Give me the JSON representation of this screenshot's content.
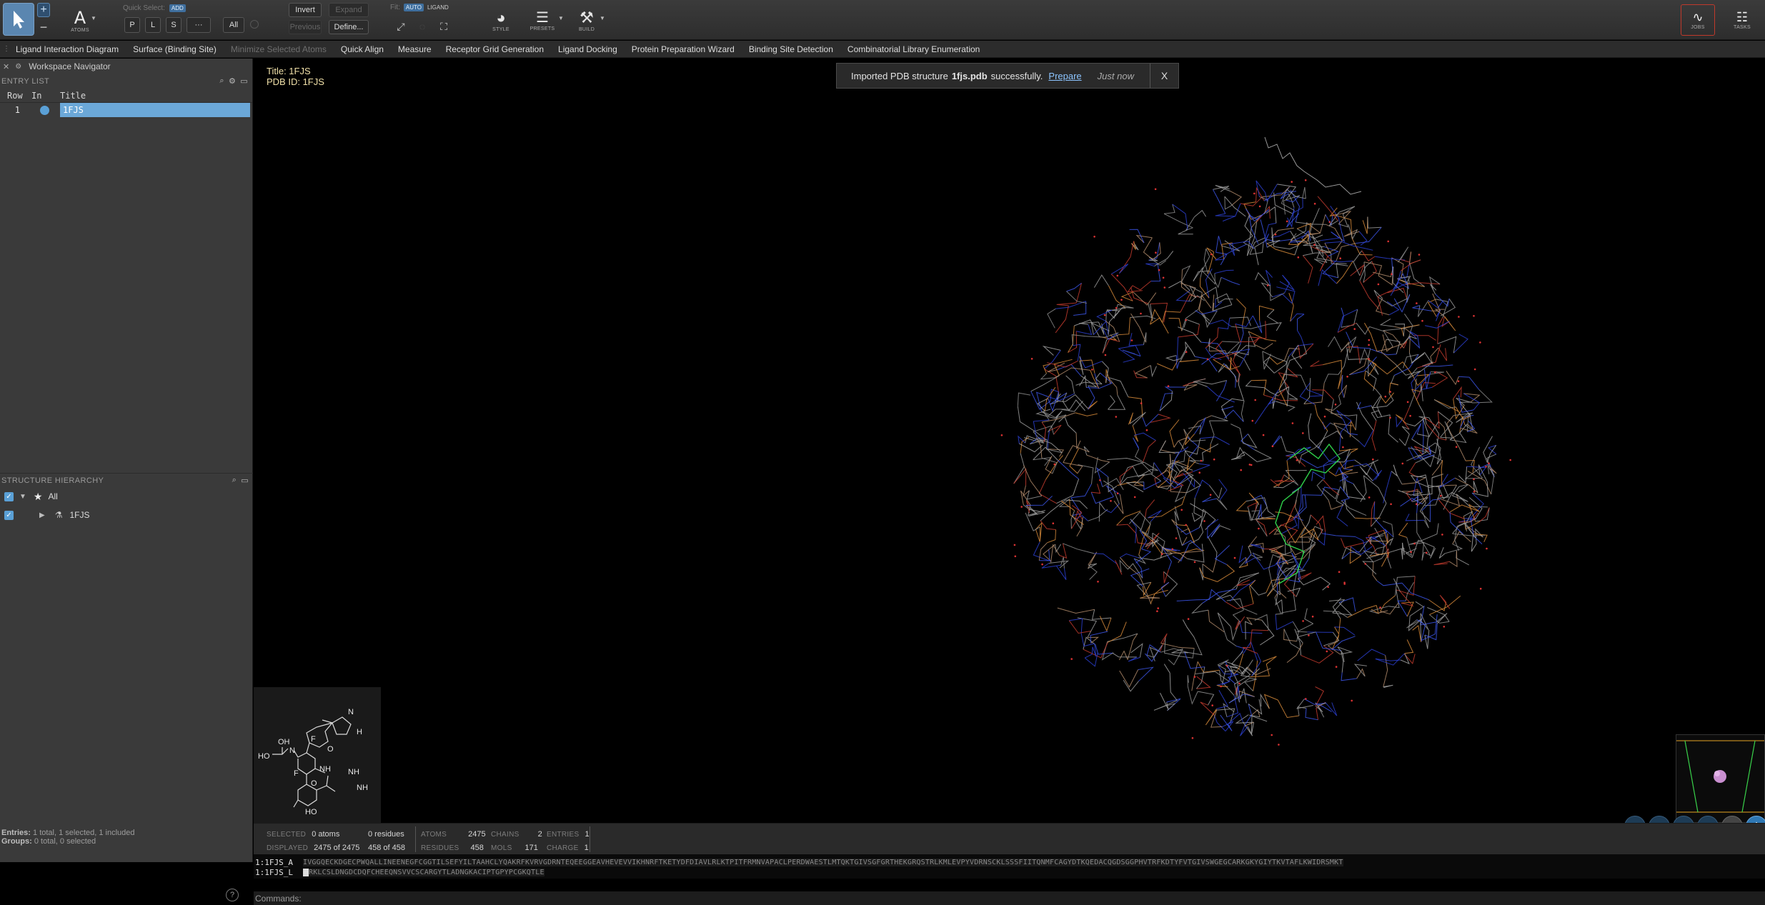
{
  "toolbar": {
    "atoms_label": "ATOMS",
    "quick_select_label": "Quick Select:",
    "quick_select_badge": "ADD",
    "btn_p": "P",
    "btn_l": "L",
    "btn_s": "S",
    "btn_more": "···",
    "btn_all": "All",
    "invert": "Invert",
    "expand": "Expand",
    "previous": "Previous",
    "define": "Define...",
    "fit_label": "Fit:",
    "fit_auto": "AUTO",
    "fit_ligand": "LIGAND",
    "style_label": "STYLE",
    "presets_label": "PRESETS",
    "build_label": "BUILD",
    "jobs_label": "JOBS",
    "tasks_label": "TASKS"
  },
  "menu": [
    {
      "label": "Ligand Interaction Diagram",
      "enabled": true
    },
    {
      "label": "Surface (Binding Site)",
      "enabled": true
    },
    {
      "label": "Minimize Selected Atoms",
      "enabled": false
    },
    {
      "label": "Quick Align",
      "enabled": true
    },
    {
      "label": "Measure",
      "enabled": true
    },
    {
      "label": "Receptor Grid Generation",
      "enabled": true
    },
    {
      "label": "Ligand Docking",
      "enabled": true
    },
    {
      "label": "Protein Preparation Wizard",
      "enabled": true
    },
    {
      "label": "Binding Site Detection",
      "enabled": true
    },
    {
      "label": "Combinatorial Library Enumeration",
      "enabled": true
    }
  ],
  "navigator": {
    "title": "Workspace Navigator",
    "entry_list_label": "ENTRY LIST",
    "columns": [
      "Row",
      "In",
      "Title"
    ],
    "rows": [
      {
        "row": "1",
        "title": "1FJS"
      }
    ],
    "structure_hierarchy_label": "STRUCTURE HIERARCHY",
    "hierarchy": [
      {
        "label": "All"
      },
      {
        "label": "1FJS"
      }
    ]
  },
  "status": {
    "entries_label": "Entries:",
    "entries_value": "1 total, 1 selected, 1 included",
    "groups_label": "Groups:",
    "groups_value": "0 total, 0 selected"
  },
  "viewer": {
    "title_line": "Title: 1FJS",
    "pdb_line": "PDB ID: 1FJS",
    "toast_prefix": "Imported PDB structure",
    "toast_file": "1fjs.pdb",
    "toast_suffix": "successfully.",
    "toast_link": "Prepare",
    "toast_time": "Just now",
    "toast_close": "X",
    "ligand_labels": {
      "oh": "OH",
      "ho1": "HO",
      "n1": "N",
      "f1": "F",
      "f2": "F",
      "o1": "O",
      "o2": "O",
      "nh": "NH",
      "nh2": "NH",
      "nh3": "NH",
      "ho2": "HO",
      "n_ring": "N",
      "h_ring": "H"
    }
  },
  "info": {
    "selected_label": "SELECTED",
    "selected_atoms": "0 atoms",
    "selected_residues": "0 residues",
    "displayed_label": "DISPLAYED",
    "displayed_atoms": "2475 of 2475",
    "displayed_residues": "458 of 458",
    "atoms_label": "ATOMS",
    "atoms_value": "2475",
    "chains_label": "CHAINS",
    "chains_value": "2",
    "entries_label": "ENTRIES",
    "entries_value": "1",
    "residues_label": "RESIDUES",
    "residues_value": "458",
    "mols_label": "MOLS",
    "mols_value": "171",
    "charge_label": "CHARGE",
    "charge_value": "1"
  },
  "sequence": {
    "chain_a_label": "1:1FJS_A",
    "chain_a_seq": "IVGGQECKDGECPWQALLINEENEGFCGGTILSEFYILTAAHCLYQAKRFKVRVGDRNTEQEEGGEAVHEVEVVIKHNRFTKETYDFDIAVLRLKTPITFRMNVAPACLPERDWAESTLMTQKTGIVSGFGRTHEKGRQSTRLKMLEVPYVDRNSCKLSSSFIITQNMFCAGYDTKQEDACQGDSGGPHVTRFKDTYFVTGIVSWGEGCARKGKYGIYTKVTAFLKWIDRSMKT",
    "chain_l_label": "1:1FJS_L",
    "chain_l_seq": "RKLCSLDNGDCDQFCHEEQNSVVCSCARGYTLADNGKACIPTGPYPCGKQTLE",
    "commands_label": "Commands:"
  },
  "help": "?"
}
